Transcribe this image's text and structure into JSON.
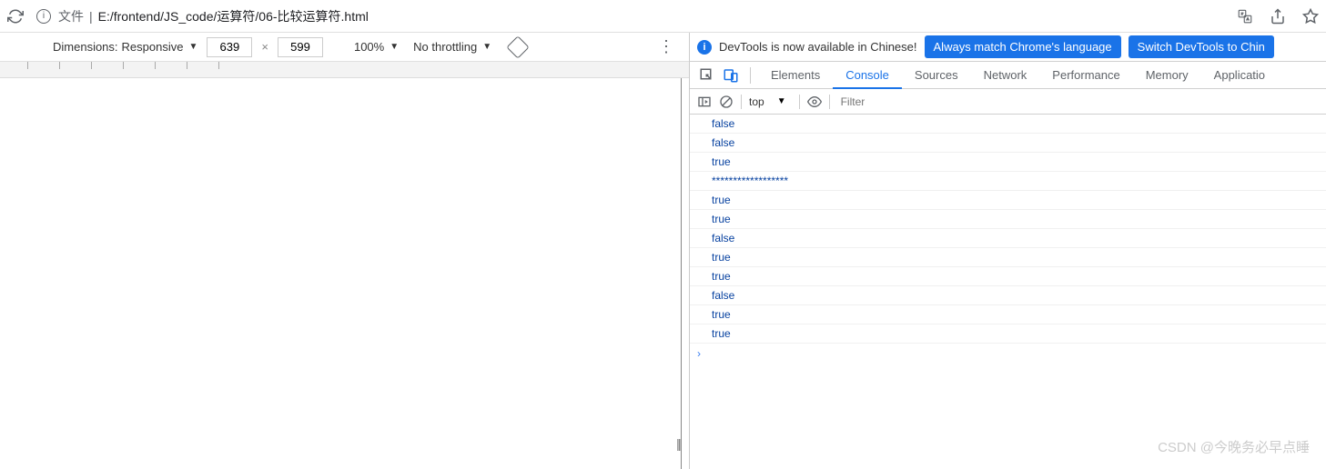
{
  "address": {
    "label": "文件",
    "path": "E:/frontend/JS_code/运算符/06-比较运算符.html"
  },
  "device": {
    "dimensions_label": "Dimensions:",
    "mode": "Responsive",
    "width": "639",
    "height": "599",
    "zoom": "100%",
    "throttling": "No throttling"
  },
  "infobar": {
    "message": "DevTools is now available in Chinese!",
    "btn1": "Always match Chrome's language",
    "btn2": "Switch DevTools to Chin"
  },
  "tabs": [
    "Elements",
    "Console",
    "Sources",
    "Network",
    "Performance",
    "Memory",
    "Applicatio"
  ],
  "active_tab": "Console",
  "console_toolbar": {
    "context": "top",
    "filter_placeholder": "Filter"
  },
  "console_logs": [
    "false",
    "false",
    "true",
    "******************",
    "true",
    "true",
    "false",
    "true",
    "true",
    "false",
    "true",
    "true"
  ],
  "prompt": "›",
  "watermark": "CSDN @今晚务必早点睡"
}
